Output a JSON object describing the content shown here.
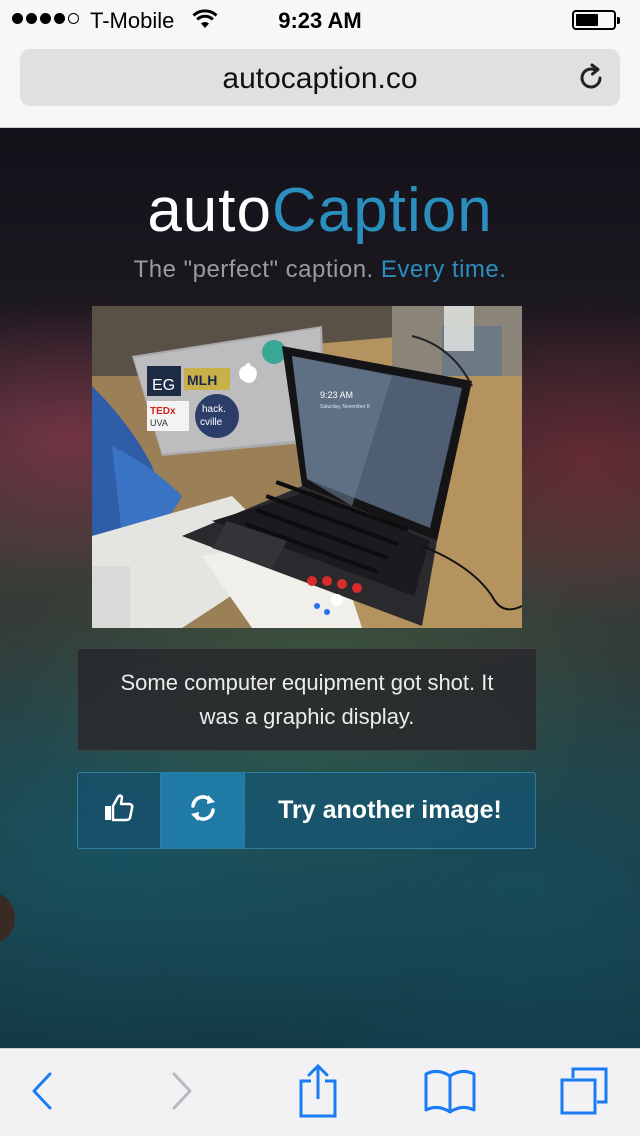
{
  "status_bar": {
    "carrier": "T-Mobile",
    "time": "9:23 AM",
    "signal_bars_filled": 4,
    "signal_bars_total": 5,
    "battery_level": 0.5
  },
  "browser": {
    "url": "autocaption.co"
  },
  "page": {
    "logo": {
      "part1": "auto",
      "part2": "Caption"
    },
    "tagline": {
      "prefix": "The \"perfect\" caption.",
      "suffix": "Every time."
    },
    "photo": {
      "screen_time": "9:23 AM",
      "screen_date": "Saturday, November 8",
      "sticker_eg": "EG",
      "sticker_mlh": "MLH",
      "sticker_ted": "TEDx",
      "sticker_uva": "UVA",
      "sticker_hack": "hack.",
      "sticker_cville": "cville"
    },
    "caption": "Some computer equipment got shot. It was a graphic display.",
    "buttons": {
      "like_icon": "thumbs-up-icon",
      "refresh_icon": "refresh-icon",
      "try_label": "Try another image!"
    }
  },
  "toolbar": {
    "icons": [
      "back-arrow-icon",
      "forward-arrow-icon",
      "share-icon",
      "bookmarks-icon",
      "tabs-icon"
    ]
  },
  "colors": {
    "accent": "#2a8fbf",
    "ios_blue": "#1a7cf5"
  }
}
